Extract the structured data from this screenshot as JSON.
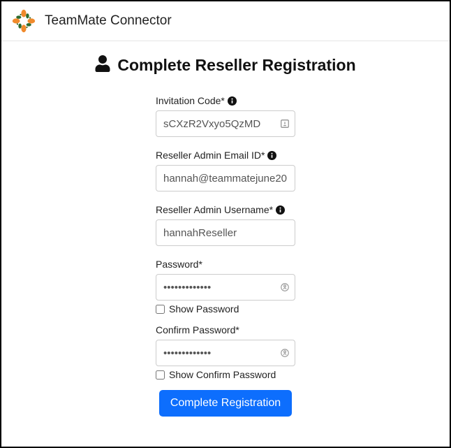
{
  "header": {
    "app_title": "TeamMate Connector"
  },
  "page": {
    "heading": "Complete Reseller Registration"
  },
  "form": {
    "invitation_code": {
      "label": "Invitation Code*",
      "value": "sCXzR2Vxyo5QzMD",
      "has_info": true
    },
    "email": {
      "label": "Reseller Admin Email ID*",
      "value": "hannah@teammatejune20",
      "has_info": true
    },
    "username": {
      "label": "Reseller Admin Username*",
      "value": "hannahReseller",
      "has_info": true
    },
    "password": {
      "label": "Password*",
      "value": "•••••••••••••",
      "show_label": "Show Password",
      "show_checked": false
    },
    "confirm_password": {
      "label": "Confirm Password*",
      "value": "•••••••••••••",
      "show_label": "Show Confirm Password",
      "show_checked": false
    },
    "submit_label": "Complete Registration"
  }
}
